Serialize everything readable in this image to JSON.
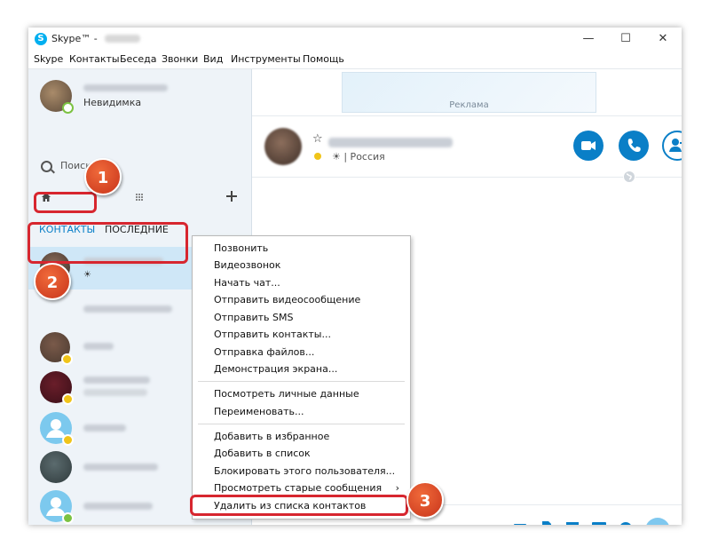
{
  "window": {
    "title": "Skype™ - ",
    "min_glyph": "—",
    "max_glyph": "☐",
    "close_glyph": "✕"
  },
  "menu": [
    "Skype",
    "Контакты",
    "Беседа",
    "Звонки",
    "Вид",
    "Инструменты",
    "Помощь"
  ],
  "profile": {
    "status": "Невидимка"
  },
  "search": {
    "label": "Поиск"
  },
  "tabs": {
    "contacts": "КОНТАКТЫ",
    "recent": "ПОСЛЕДНИЕ"
  },
  "selected_contact": {
    "mood": "☀"
  },
  "ad": {
    "label": "Реклама"
  },
  "chat_header": {
    "location": "☀ | Россия"
  },
  "context_menu": {
    "group1": [
      "Позвонить",
      "Видеозвонок",
      "Начать чат...",
      "Отправить видеосообщение",
      "Отправить SMS",
      "Отправить контакты...",
      "Отправка файлов...",
      "Демонстрация экрана..."
    ],
    "group2": [
      "Посмотреть личные данные",
      "Переименовать..."
    ],
    "group3": [
      "Добавить в избранное",
      "Добавить в список",
      "Блокировать этого пользователя...",
      "Просмотреть старые сообщения",
      "Удалить из списка контактов"
    ],
    "submenu_arrow": "›"
  },
  "badges": [
    "1",
    "2",
    "3"
  ],
  "colors": {
    "accent": "#0a7fc7",
    "highlight": "#d7262f",
    "badge": "#e0502a",
    "sidebar_bg": "#eef3f8",
    "selected_row": "#cfe7f7"
  },
  "icons": [
    "skype-logo-icon",
    "search-icon",
    "home-icon",
    "dialpad-icon",
    "plus-icon",
    "video-call-icon",
    "audio-call-icon",
    "add-contact-icon",
    "globe-icon",
    "send-icon"
  ]
}
